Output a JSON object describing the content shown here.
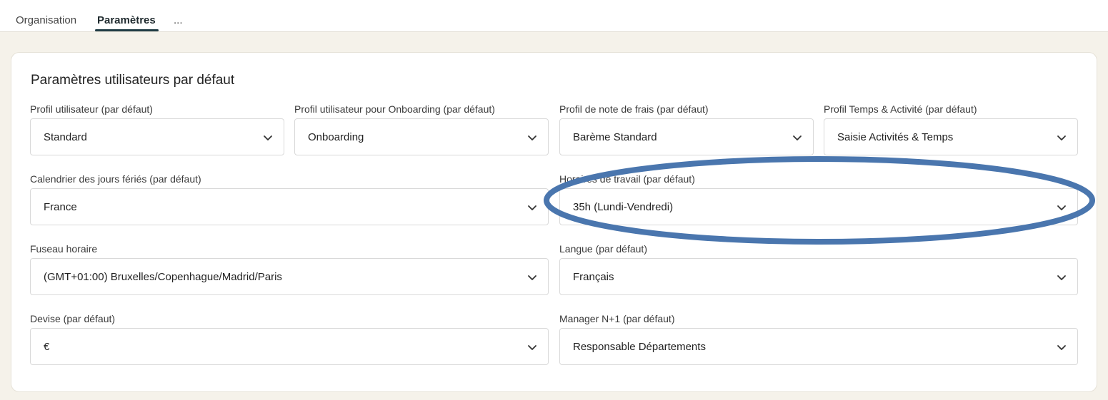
{
  "tabs": [
    {
      "label": "Organisation",
      "active": false
    },
    {
      "label": "Paramètres",
      "active": true
    },
    {
      "label": "...",
      "active": false
    }
  ],
  "section": {
    "title": "Paramètres utilisateurs par défaut"
  },
  "fields": {
    "user_profile": {
      "label": "Profil utilisateur (par défaut)",
      "value": "Standard"
    },
    "onboarding_profile": {
      "label": "Profil utilisateur pour Onboarding (par défaut)",
      "value": "Onboarding"
    },
    "expense_profile": {
      "label": "Profil de note de frais (par défaut)",
      "value": "Barème Standard"
    },
    "time_profile": {
      "label": "Profil Temps & Activité (par défaut)",
      "value": "Saisie Activités & Temps"
    },
    "holiday_calendar": {
      "label": "Calendrier des jours fériés (par défaut)",
      "value": "France"
    },
    "work_schedule": {
      "label": "Horaires de travail (par défaut)",
      "value": "35h (Lundi-Vendredi)"
    },
    "timezone": {
      "label": "Fuseau horaire",
      "value": "(GMT+01:00) Bruxelles/Copenhague/Madrid/Paris"
    },
    "language": {
      "label": "Langue (par défaut)",
      "value": "Français"
    },
    "currency": {
      "label": "Devise (par défaut)",
      "value": "€"
    },
    "manager": {
      "label": "Manager N+1 (par défaut)",
      "value": "Responsable Départements"
    }
  },
  "colors": {
    "highlight_ellipse": "#4a76ae",
    "active_tab_underline": "#1f3b44",
    "background": "#f5f2ea"
  },
  "icons": {
    "dropdown": "chevron-down-icon"
  }
}
